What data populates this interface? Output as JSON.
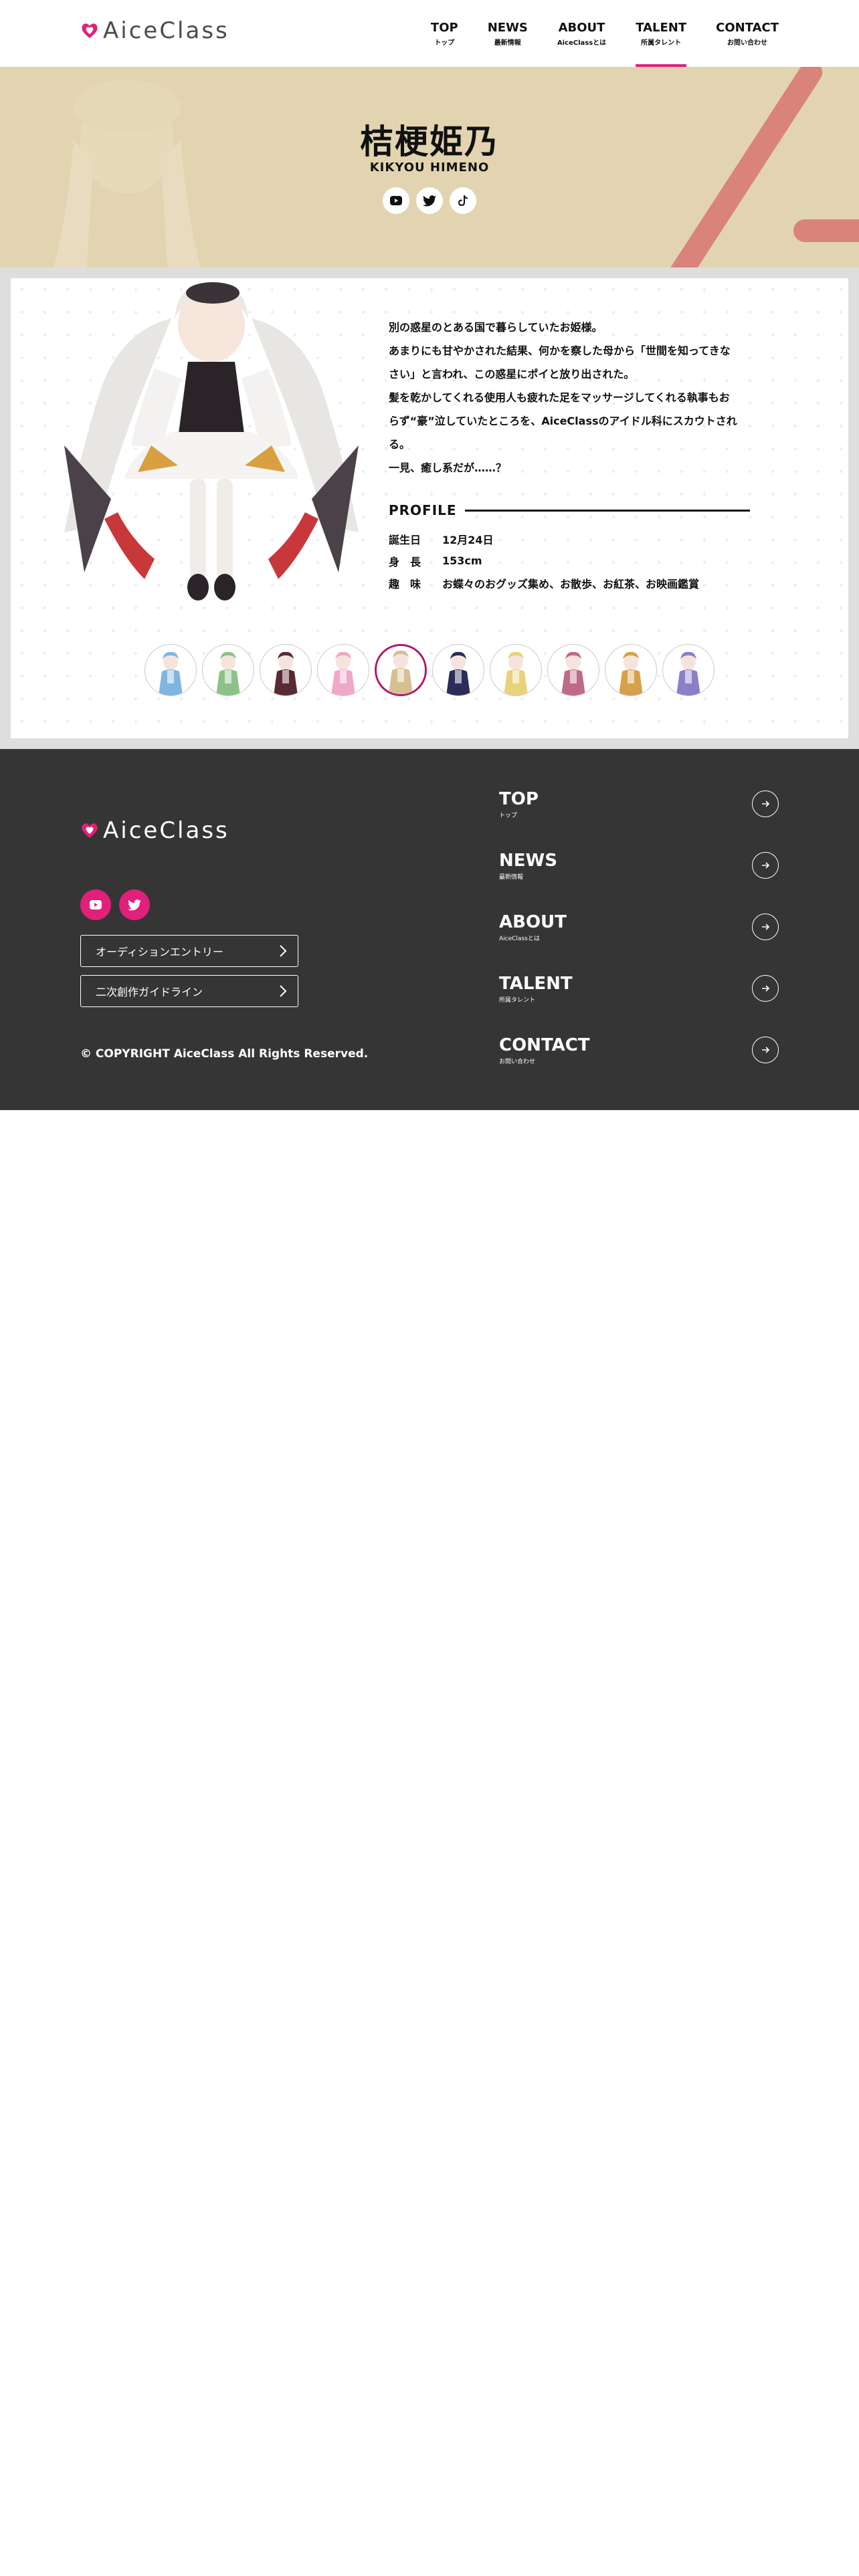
{
  "header": {
    "logo_text": "AiceClass",
    "nav": [
      {
        "en": "TOP",
        "ja": "トップ"
      },
      {
        "en": "NEWS",
        "ja": "最新情報"
      },
      {
        "en": "ABOUT",
        "ja": "AiceClassとは"
      },
      {
        "en": "TALENT",
        "ja": "所属タレント"
      },
      {
        "en": "CONTACT",
        "ja": "お問い合わせ"
      }
    ],
    "active_nav": "TALENT"
  },
  "talent": {
    "name": "桔梗姫乃",
    "roman": "KIKYOU HIMENO",
    "social": [
      "youtube-icon",
      "twitter-icon",
      "tiktok-icon"
    ],
    "description": [
      "別の惑星のとある国で暮らしていたお姫様。",
      "あまりにも甘やかされた結果、何かを察した母から「世間を知ってきな",
      "さい」と言われ、この惑星にポイと放り出された。",
      "髪を乾かしてくれる使用人も疲れた足をマッサージしてくれる執事もお",
      "らず“豪”泣していたところを、AiceClassのアイドル科にスカウトされ",
      "る。",
      "一見、癒し系だが……？"
    ],
    "profile_title": "PROFILE",
    "profile": [
      {
        "key": "誕生日",
        "value": "12月24日"
      },
      {
        "key": "身　長",
        "value": "153cm"
      },
      {
        "key": "趣　味",
        "value": "お蝶々のおグッズ集め、お散歩、お紅茶、お映画鑑賞"
      }
    ]
  },
  "thumbnails": {
    "count": 10,
    "active_index": 4,
    "colors": [
      "#7fb6e0",
      "#8cc28a",
      "#5a2a34",
      "#f0a8c8",
      "#d4c090",
      "#2a2d5a",
      "#e8d27a",
      "#c06a8a",
      "#d8a04a",
      "#8a80c8"
    ]
  },
  "footer": {
    "logo_text": "AiceClass",
    "buttons": [
      "オーディションエントリー",
      "二次創作ガイドライン"
    ],
    "copyright": "© COPYRIGHT AiceClass All Rights Reserved.",
    "nav": [
      {
        "en": "TOP",
        "ja": "トップ"
      },
      {
        "en": "NEWS",
        "ja": "最新情報"
      },
      {
        "en": "ABOUT",
        "ja": "AiceClassとは"
      },
      {
        "en": "TALENT",
        "ja": "所属タレント"
      },
      {
        "en": "CONTACT",
        "ja": "お問い合わせ"
      }
    ]
  },
  "colors": {
    "accent": "#e0207a",
    "hero_bg": "#e2d4b0",
    "stripe": "#d9837a",
    "footer_bg": "#353535",
    "active_thumb": "#b0186a"
  }
}
